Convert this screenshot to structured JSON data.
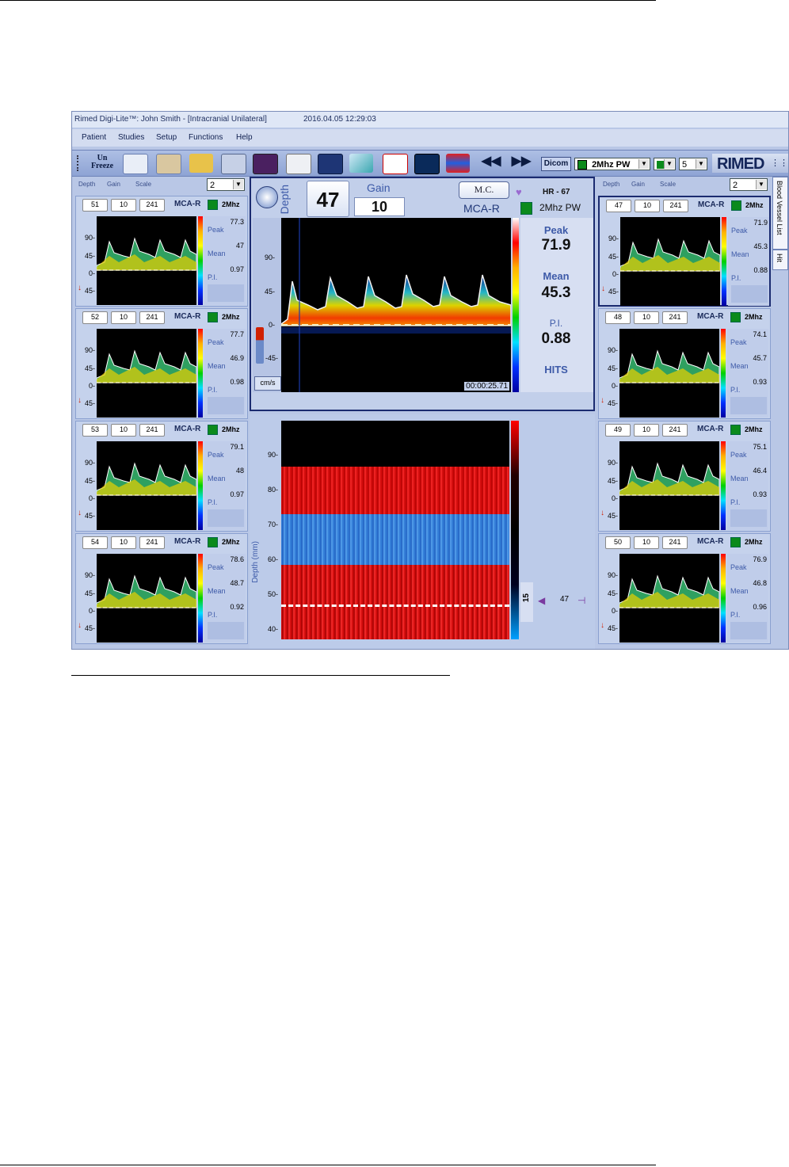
{
  "app": {
    "title": "Rimed Digi-Lite™: John Smith - [Intracranial Unilateral]",
    "datetime": "2016.04.05 12:29:03",
    "brand": "RIMED"
  },
  "menu": [
    "Patient",
    "Studies",
    "Setup",
    "Functions",
    "Help"
  ],
  "toolbar": {
    "unfreeze_label": "Un Freeze",
    "dicom_label": "Dicom",
    "probe_select": "2Mhz PW",
    "count_select": "5"
  },
  "side_headers": [
    "Depth",
    "Gain",
    "Scale"
  ],
  "left_scale_select": "2",
  "right_scale_select": "2",
  "side_tab_labels": [
    "Blood Vessel List",
    "Hit"
  ],
  "mini_axis": [
    "90-",
    "45-",
    "0-",
    "45-"
  ],
  "mini_labels": {
    "peak": "Peak",
    "mean": "Mean",
    "pi": "P.I."
  },
  "left_channels": [
    {
      "depth": "51",
      "gain": "10",
      "scale": "241",
      "vessel": "MCA-R",
      "freq": "2Mhz",
      "peak": "77.3",
      "mean": "47",
      "pi": "0.97"
    },
    {
      "depth": "52",
      "gain": "10",
      "scale": "241",
      "vessel": "MCA-R",
      "freq": "2Mhz",
      "peak": "77.7",
      "mean": "46.9",
      "pi": "0.98"
    },
    {
      "depth": "53",
      "gain": "10",
      "scale": "241",
      "vessel": "MCA-R",
      "freq": "2Mhz",
      "peak": "79.1",
      "mean": "48",
      "pi": "0.97"
    },
    {
      "depth": "54",
      "gain": "10",
      "scale": "241",
      "vessel": "MCA-R",
      "freq": "2Mhz",
      "peak": "78.6",
      "mean": "48.7",
      "pi": "0.92"
    }
  ],
  "right_channels": [
    {
      "depth": "47",
      "gain": "10",
      "scale": "241",
      "vessel": "MCA-R",
      "freq": "2Mhz",
      "peak": "71.9",
      "mean": "45.3",
      "pi": "0.88"
    },
    {
      "depth": "48",
      "gain": "10",
      "scale": "241",
      "vessel": "MCA-R",
      "freq": "2Mhz",
      "peak": "74.1",
      "mean": "45.7",
      "pi": "0.93"
    },
    {
      "depth": "49",
      "gain": "10",
      "scale": "241",
      "vessel": "MCA-R",
      "freq": "2Mhz",
      "peak": "75.1",
      "mean": "46.4",
      "pi": "0.93"
    },
    {
      "depth": "50",
      "gain": "10",
      "scale": "241",
      "vessel": "MCA-R",
      "freq": "2Mhz",
      "peak": "76.9",
      "mean": "46.8",
      "pi": "0.96"
    }
  ],
  "main": {
    "depth_label": "Depth",
    "depth_value": "47",
    "gain_label": "Gain",
    "gain_value": "10",
    "mc_label": "M.C.",
    "hr": "HR - 67",
    "vessel": "MCA-R",
    "mode": "2Mhz PW",
    "axis": [
      "90-",
      "45-",
      "0-",
      "-45-"
    ],
    "units": "cm/s",
    "timer": "00:00:25.71",
    "peak_label": "Peak",
    "peak": "71.9",
    "mean_label": "Mean",
    "mean": "45.3",
    "pi_label": "P.I.",
    "pi": "0.88",
    "hits_label": "HITS"
  },
  "mmode": {
    "ylabel": "Depth (mm)",
    "axis": [
      "90-",
      "80-",
      "70-",
      "60-",
      "50-",
      "40-"
    ],
    "gate_value": "15",
    "depth_marker": "47"
  },
  "colors": {
    "frame": "#1b2b70",
    "panel": "#c2cfea",
    "status_green": "#0b8a1c",
    "flow_red": "#e01010",
    "flow_blue": "#3a8ae0"
  }
}
